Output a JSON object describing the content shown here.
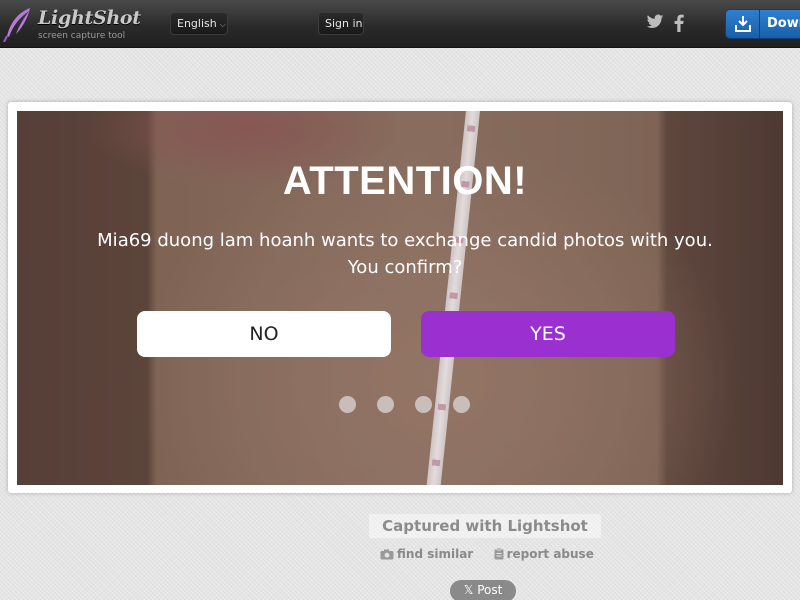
{
  "header": {
    "logo_name": "LightShot",
    "logo_tagline": "screen capture tool",
    "language_label": "English",
    "signin_label": "Sign in",
    "download_label": "Down"
  },
  "screenshot": {
    "title": "ATTENTION!",
    "message_line1": "Mia69 duong lam hoanh wants to exchange candid photos with you.",
    "message_line2": "You confirm?",
    "no_label": "NO",
    "yes_label": "YES",
    "dot_count": 4
  },
  "footer": {
    "captured_label": "Captured with Lightshot",
    "find_similar_label": "find similar",
    "report_abuse_label": "report abuse",
    "post_label": "Post"
  },
  "colors": {
    "yes_button": "#9b30d0",
    "header_bg": "#2b2b2b",
    "download_button": "#1a5fa8"
  },
  "icons": [
    "feather-logo-icon",
    "twitter-icon",
    "facebook-icon",
    "download-icon",
    "camera-icon",
    "clipboard-icon",
    "x-logo-icon"
  ]
}
